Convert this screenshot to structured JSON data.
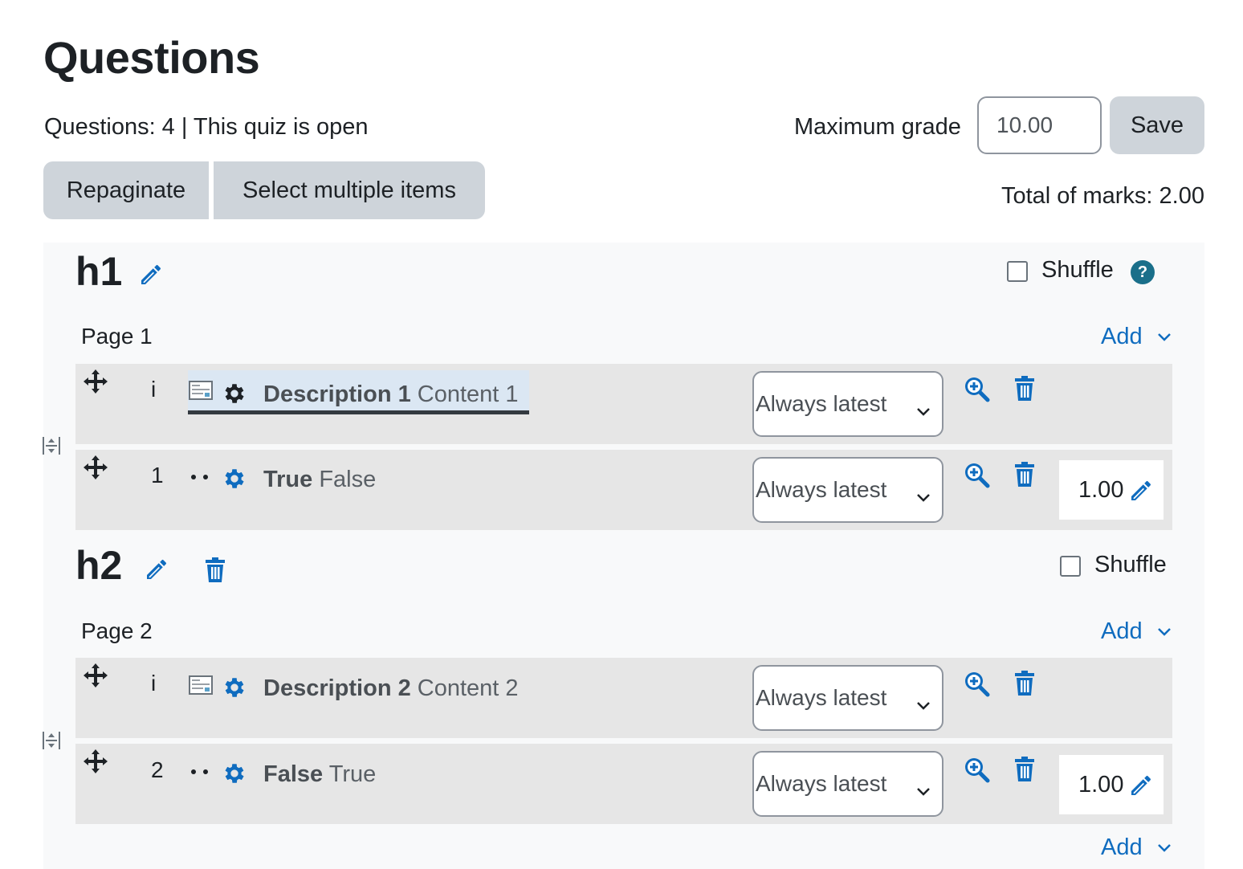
{
  "page": {
    "title": "Questions",
    "info": "Questions: 4 | This quiz is open",
    "max_grade_label": "Maximum grade",
    "max_grade_value": "10.00",
    "save_label": "Save",
    "repaginate_label": "Repaginate",
    "select_multiple_label": "Select multiple items",
    "total_marks": "Total of marks: 2.00"
  },
  "sections": [
    {
      "heading": "h1",
      "shuffle_label": "Shuffle",
      "shuffle_checked": false,
      "page_label": "Page 1",
      "add_label": "Add",
      "slots": [
        {
          "number": "i",
          "type": "description",
          "name": "Description 1",
          "content": "Content 1",
          "version": "Always latest"
        },
        {
          "number": "1",
          "type": "truefalse",
          "name": "True",
          "content": "False",
          "version": "Always latest",
          "mark": "1.00"
        }
      ]
    },
    {
      "heading": "h2",
      "shuffle_label": "Shuffle",
      "shuffle_checked": false,
      "page_label": "Page 2",
      "add_label": "Add",
      "slots": [
        {
          "number": "i",
          "type": "description",
          "name": "Description 2",
          "content": "Content 2",
          "version": "Always latest"
        },
        {
          "number": "2",
          "type": "truefalse",
          "name": "False",
          "content": "True",
          "version": "Always latest",
          "mark": "1.00"
        }
      ]
    }
  ],
  "footer_add_label": "Add",
  "colors": {
    "accent": "#0f6cbf",
    "button_bg": "#ced4da",
    "slot_bg": "#e6e6e6",
    "section_bg": "#f8f9fa",
    "help": "#1a6f8a"
  },
  "icons": [
    "move-icon",
    "gear-icon",
    "description-icon",
    "zoom-in-icon",
    "trash-icon",
    "pencil-icon",
    "help-icon",
    "chevron-down-icon",
    "page-toggle-icon"
  ]
}
